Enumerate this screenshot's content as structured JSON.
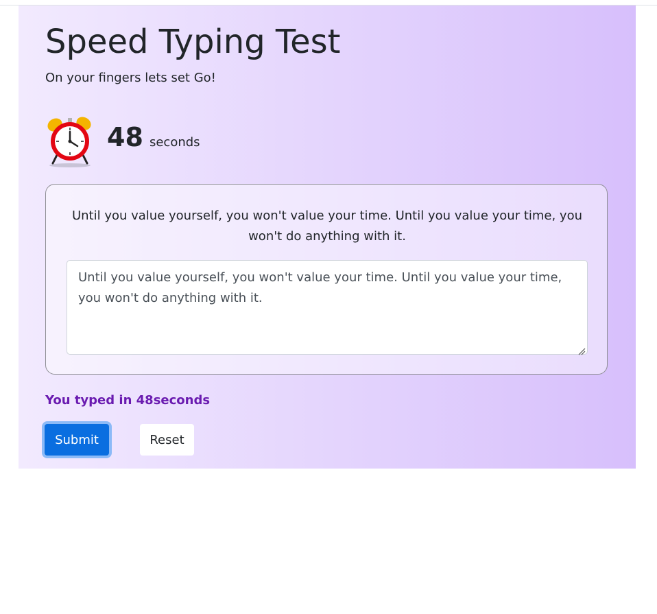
{
  "header": {
    "title": "Speed Typing Test",
    "subtitle": "On your fingers lets set Go!"
  },
  "timer": {
    "value": "48",
    "unit": "seconds",
    "icon": "alarm-clock-icon"
  },
  "quote": {
    "text": "Until you value yourself, you won't value your time. Until you value your time, you won't do anything with it."
  },
  "typing_input": {
    "value": "Until you value yourself, you won't value your time. Until you value your time, you won't do anything with it.",
    "placeholder": ""
  },
  "result": {
    "text": "You typed in 48seconds"
  },
  "buttons": {
    "submit_label": "Submit",
    "reset_label": "Reset"
  },
  "colors": {
    "result_text": "#6a1bb0",
    "submit_bg": "#0a6ee0",
    "panel_gradient_start": "#f2eafe",
    "panel_gradient_end": "#d7bffc"
  }
}
